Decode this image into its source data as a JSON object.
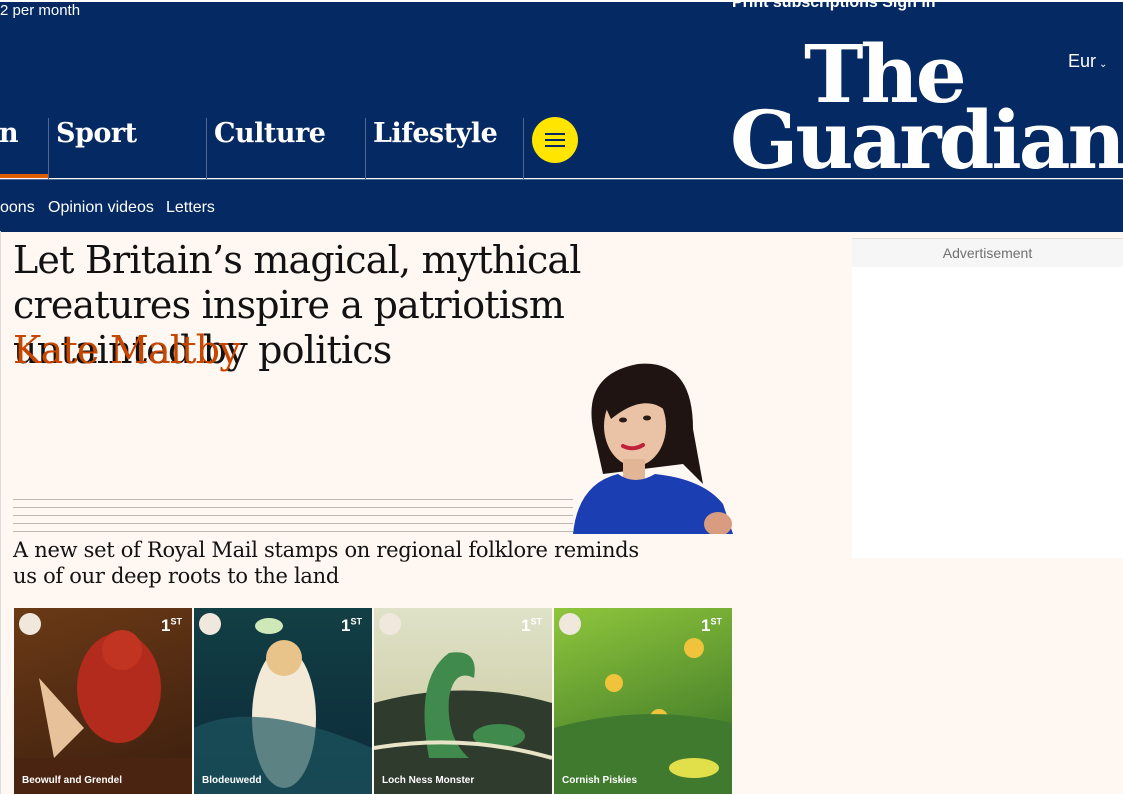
{
  "top_bar": {
    "support_text": "2 per month",
    "utility_text": "Print subscriptions   Sign in"
  },
  "header": {
    "edition": "Eur",
    "logo_line1": "The",
    "logo_line2": "Guardian",
    "pillars": [
      {
        "label": "n"
      },
      {
        "label": "Sport"
      },
      {
        "label": "Culture"
      },
      {
        "label": "Lifestyle"
      }
    ],
    "active_pillar_color": "#e05e00",
    "menu_button_color": "#ffe500",
    "brand_color": "#052962"
  },
  "subnav": {
    "items": [
      "oons",
      "Opinion videos",
      "Letters"
    ]
  },
  "article": {
    "headline": "Let Britain’s magical, mythical creatures inspire a patriotism untainted by politics",
    "byline": "Kate Maltby",
    "byline_color": "#c74600",
    "standfirst": "A new set of Royal Mail stamps on regional folklore reminds us of our deep roots to the land"
  },
  "ad": {
    "label": "Advertisement"
  },
  "stamps": [
    {
      "title": "Beowulf and Grendel",
      "value": "1",
      "suffix": "ST"
    },
    {
      "title": "Blodeuwedd",
      "value": "1",
      "suffix": "ST"
    },
    {
      "title": "Loch Ness Monster",
      "value": "1",
      "suffix": "ST"
    },
    {
      "title": "Cornish Piskies",
      "value": "1",
      "suffix": "ST"
    }
  ]
}
